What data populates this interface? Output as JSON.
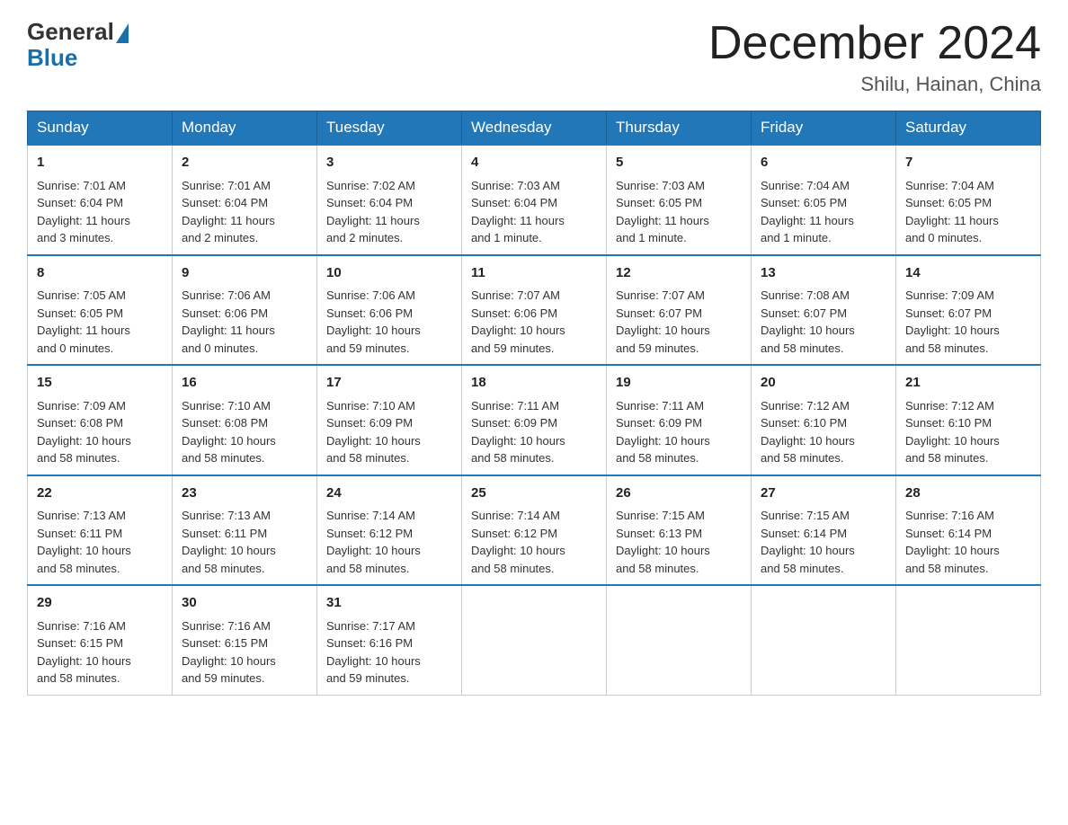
{
  "header": {
    "logo_general": "General",
    "logo_blue": "Blue",
    "title": "December 2024",
    "location": "Shilu, Hainan, China"
  },
  "weekdays": [
    "Sunday",
    "Monday",
    "Tuesday",
    "Wednesday",
    "Thursday",
    "Friday",
    "Saturday"
  ],
  "weeks": [
    [
      {
        "day": "1",
        "sunrise": "7:01 AM",
        "sunset": "6:04 PM",
        "daylight": "11 hours and 3 minutes."
      },
      {
        "day": "2",
        "sunrise": "7:01 AM",
        "sunset": "6:04 PM",
        "daylight": "11 hours and 2 minutes."
      },
      {
        "day": "3",
        "sunrise": "7:02 AM",
        "sunset": "6:04 PM",
        "daylight": "11 hours and 2 minutes."
      },
      {
        "day": "4",
        "sunrise": "7:03 AM",
        "sunset": "6:04 PM",
        "daylight": "11 hours and 1 minute."
      },
      {
        "day": "5",
        "sunrise": "7:03 AM",
        "sunset": "6:05 PM",
        "daylight": "11 hours and 1 minute."
      },
      {
        "day": "6",
        "sunrise": "7:04 AM",
        "sunset": "6:05 PM",
        "daylight": "11 hours and 1 minute."
      },
      {
        "day": "7",
        "sunrise": "7:04 AM",
        "sunset": "6:05 PM",
        "daylight": "11 hours and 0 minutes."
      }
    ],
    [
      {
        "day": "8",
        "sunrise": "7:05 AM",
        "sunset": "6:05 PM",
        "daylight": "11 hours and 0 minutes."
      },
      {
        "day": "9",
        "sunrise": "7:06 AM",
        "sunset": "6:06 PM",
        "daylight": "11 hours and 0 minutes."
      },
      {
        "day": "10",
        "sunrise": "7:06 AM",
        "sunset": "6:06 PM",
        "daylight": "10 hours and 59 minutes."
      },
      {
        "day": "11",
        "sunrise": "7:07 AM",
        "sunset": "6:06 PM",
        "daylight": "10 hours and 59 minutes."
      },
      {
        "day": "12",
        "sunrise": "7:07 AM",
        "sunset": "6:07 PM",
        "daylight": "10 hours and 59 minutes."
      },
      {
        "day": "13",
        "sunrise": "7:08 AM",
        "sunset": "6:07 PM",
        "daylight": "10 hours and 58 minutes."
      },
      {
        "day": "14",
        "sunrise": "7:09 AM",
        "sunset": "6:07 PM",
        "daylight": "10 hours and 58 minutes."
      }
    ],
    [
      {
        "day": "15",
        "sunrise": "7:09 AM",
        "sunset": "6:08 PM",
        "daylight": "10 hours and 58 minutes."
      },
      {
        "day": "16",
        "sunrise": "7:10 AM",
        "sunset": "6:08 PM",
        "daylight": "10 hours and 58 minutes."
      },
      {
        "day": "17",
        "sunrise": "7:10 AM",
        "sunset": "6:09 PM",
        "daylight": "10 hours and 58 minutes."
      },
      {
        "day": "18",
        "sunrise": "7:11 AM",
        "sunset": "6:09 PM",
        "daylight": "10 hours and 58 minutes."
      },
      {
        "day": "19",
        "sunrise": "7:11 AM",
        "sunset": "6:09 PM",
        "daylight": "10 hours and 58 minutes."
      },
      {
        "day": "20",
        "sunrise": "7:12 AM",
        "sunset": "6:10 PM",
        "daylight": "10 hours and 58 minutes."
      },
      {
        "day": "21",
        "sunrise": "7:12 AM",
        "sunset": "6:10 PM",
        "daylight": "10 hours and 58 minutes."
      }
    ],
    [
      {
        "day": "22",
        "sunrise": "7:13 AM",
        "sunset": "6:11 PM",
        "daylight": "10 hours and 58 minutes."
      },
      {
        "day": "23",
        "sunrise": "7:13 AM",
        "sunset": "6:11 PM",
        "daylight": "10 hours and 58 minutes."
      },
      {
        "day": "24",
        "sunrise": "7:14 AM",
        "sunset": "6:12 PM",
        "daylight": "10 hours and 58 minutes."
      },
      {
        "day": "25",
        "sunrise": "7:14 AM",
        "sunset": "6:12 PM",
        "daylight": "10 hours and 58 minutes."
      },
      {
        "day": "26",
        "sunrise": "7:15 AM",
        "sunset": "6:13 PM",
        "daylight": "10 hours and 58 minutes."
      },
      {
        "day": "27",
        "sunrise": "7:15 AM",
        "sunset": "6:14 PM",
        "daylight": "10 hours and 58 minutes."
      },
      {
        "day": "28",
        "sunrise": "7:16 AM",
        "sunset": "6:14 PM",
        "daylight": "10 hours and 58 minutes."
      }
    ],
    [
      {
        "day": "29",
        "sunrise": "7:16 AM",
        "sunset": "6:15 PM",
        "daylight": "10 hours and 58 minutes."
      },
      {
        "day": "30",
        "sunrise": "7:16 AM",
        "sunset": "6:15 PM",
        "daylight": "10 hours and 59 minutes."
      },
      {
        "day": "31",
        "sunrise": "7:17 AM",
        "sunset": "6:16 PM",
        "daylight": "10 hours and 59 minutes."
      },
      null,
      null,
      null,
      null
    ]
  ]
}
